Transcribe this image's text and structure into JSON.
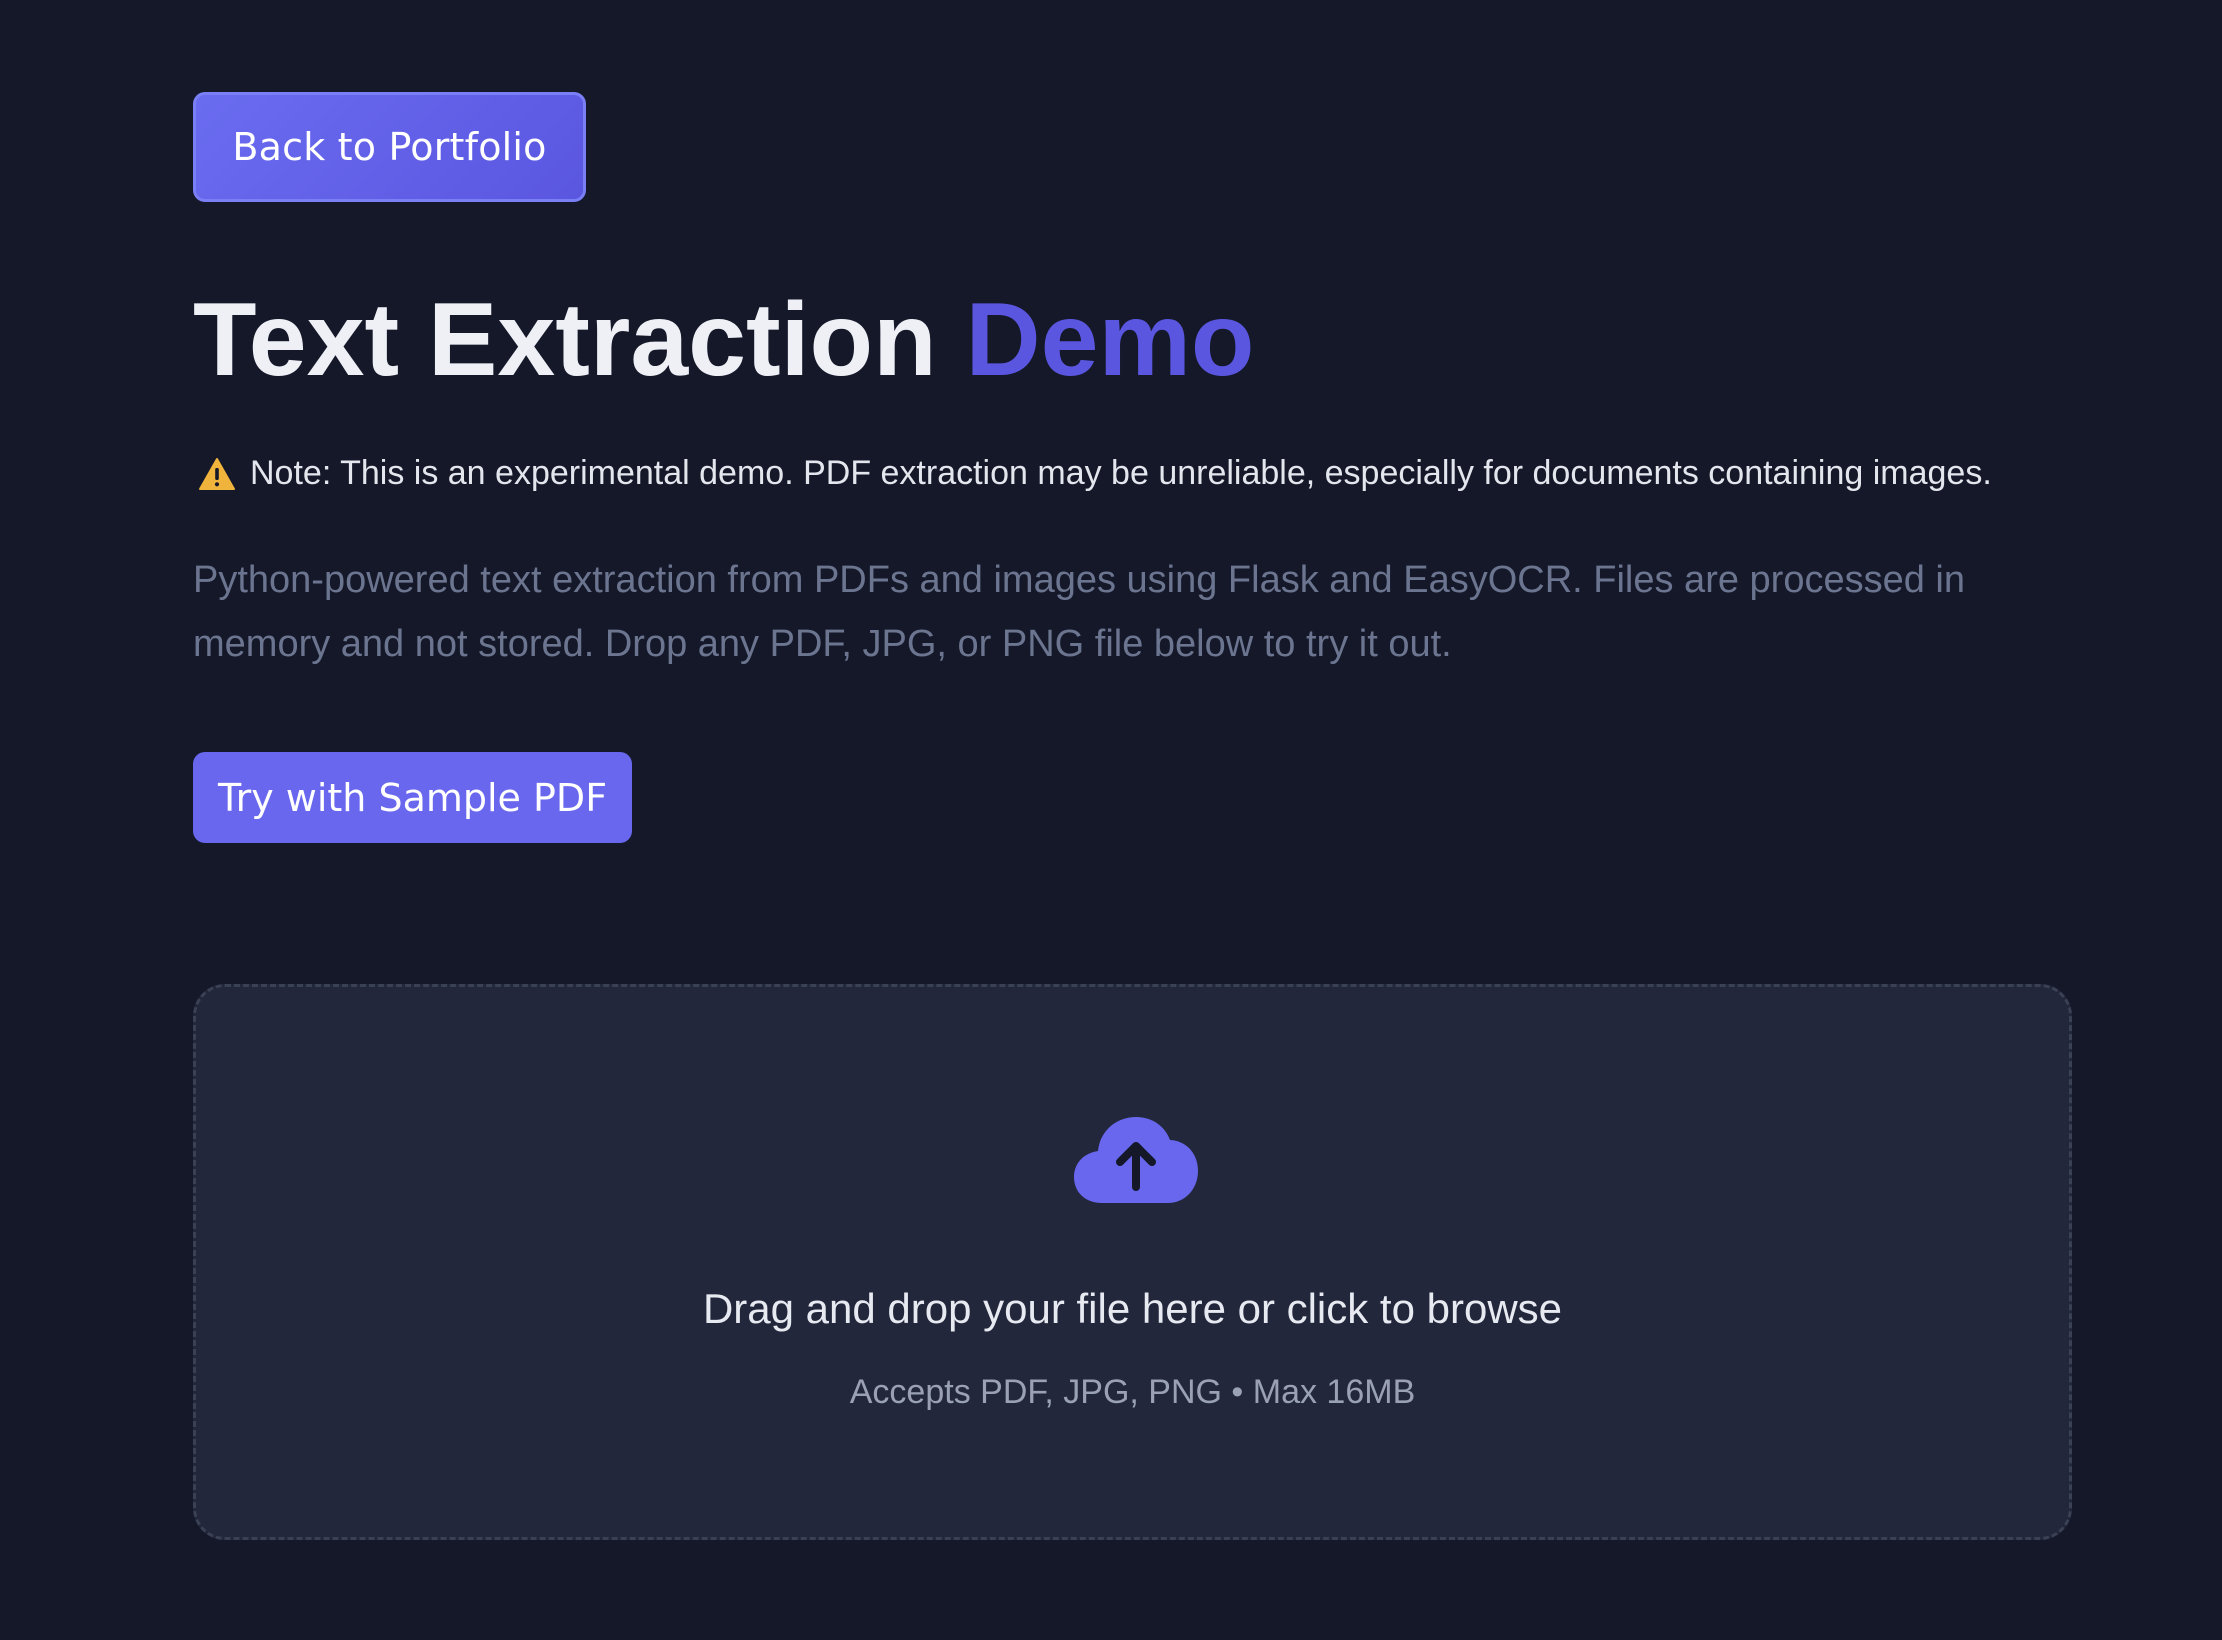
{
  "nav": {
    "back_label": "Back to Portfolio"
  },
  "header": {
    "title_main": "Text Extraction",
    "title_accent": "Demo"
  },
  "note": {
    "icon": "warning-icon",
    "text": "Note: This is an experimental demo. PDF extraction may be unreliable, especially for documents containing images."
  },
  "description": "Python-powered text extraction from PDFs and images using Flask and EasyOCR. Files are processed in memory and not stored. Drop any PDF, JPG, or PNG file below to try it out.",
  "actions": {
    "sample_label": "Try with Sample PDF"
  },
  "dropzone": {
    "icon": "cloud-upload-icon",
    "title": "Drag and drop your file here or click to browse",
    "subtitle": "Accepts PDF, JPG, PNG • Max 16MB"
  },
  "colors": {
    "background": "#141829",
    "accent": "#5a56e0",
    "button": "#6867ee",
    "panel": "#22273b",
    "warning": "#f0b43c"
  }
}
